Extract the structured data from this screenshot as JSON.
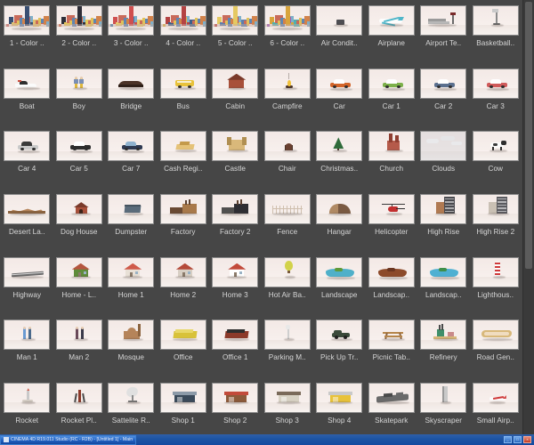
{
  "window": {
    "taskbar_title": "CINEMA 4D R19.011 Studio (RC - R2B) - [Untitled 1] - Main",
    "minimize_label": "_",
    "maximize_label": "□",
    "close_label": "×"
  },
  "browser": {
    "name": "content-browser-grid",
    "columns": 10,
    "rows": 7,
    "background_color": "#464646",
    "caption_color": "#d6d6d6",
    "thumbnail_border_color": "#8c8c8c"
  },
  "assets": [
    {
      "label": "1 - Color ..",
      "kind": "city-scene",
      "palette": [
        "#c86a6a",
        "#3a4f72",
        "#e0c070"
      ]
    },
    {
      "label": "2 - Color ..",
      "kind": "city-scene",
      "palette": [
        "#d86a4a",
        "#2e2e38",
        "#e6c85a"
      ]
    },
    {
      "label": "3 - Color ..",
      "kind": "city-scene",
      "palette": [
        "#3f7fb5",
        "#cf4f4f",
        "#e8cd6a"
      ]
    },
    {
      "label": "4 - Color ..",
      "kind": "city-scene",
      "palette": [
        "#e0b84a",
        "#b44343",
        "#3b5f8a"
      ]
    },
    {
      "label": "5 - Color ..",
      "kind": "city-scene",
      "palette": [
        "#c24a4a",
        "#e5c962",
        "#5c7fae"
      ]
    },
    {
      "label": "6 - Color ..",
      "kind": "city-scene",
      "palette": [
        "#9b5bbf",
        "#d8a43c",
        "#4fb0b0"
      ]
    },
    {
      "label": "Air Condit..",
      "kind": "air-conditioner",
      "palette": [
        "#4d4d52"
      ]
    },
    {
      "label": "Airplane",
      "kind": "airplane",
      "palette": [
        "#4fb6c9",
        "#ffffff"
      ]
    },
    {
      "label": "Airport Te..",
      "kind": "airport-terminal",
      "palette": [
        "#9a9a9a",
        "#d2b24a"
      ]
    },
    {
      "label": "Basketball..",
      "kind": "basketball-hoop",
      "palette": [
        "#888888"
      ]
    },
    {
      "label": "Boat",
      "kind": "boat",
      "palette": [
        "#ffffff",
        "#2e2e2e",
        "#c94a3c"
      ]
    },
    {
      "label": "Boy",
      "kind": "boy",
      "palette": [
        "#e0b83c",
        "#7a8fb5"
      ]
    },
    {
      "label": "Bridge",
      "kind": "bridge",
      "palette": [
        "#4a3226"
      ]
    },
    {
      "label": "Bus",
      "kind": "bus",
      "palette": [
        "#e8c23a",
        "#2e2e2e"
      ]
    },
    {
      "label": "Cabin",
      "kind": "cabin",
      "palette": [
        "#a8503a",
        "#7a3a2a"
      ]
    },
    {
      "label": "Campfire",
      "kind": "campfire",
      "palette": [
        "#f2c23a",
        "#4a3226"
      ]
    },
    {
      "label": "Car",
      "kind": "car",
      "palette": [
        "#d2652a",
        "#ffffff"
      ]
    },
    {
      "label": "Car 1",
      "kind": "car",
      "palette": [
        "#7cb04a",
        "#ffffff"
      ]
    },
    {
      "label": "Car 2",
      "kind": "car",
      "palette": [
        "#5a6f8e",
        "#ffffff"
      ]
    },
    {
      "label": "Car 3",
      "kind": "car",
      "palette": [
        "#cf5a5a",
        "#ffffff"
      ]
    },
    {
      "label": "Car 4",
      "kind": "car",
      "palette": [
        "#c9c9c9",
        "#3a3a3a"
      ]
    },
    {
      "label": "Car 5",
      "kind": "car",
      "palette": [
        "#2e2e2e",
        "#ffffff"
      ]
    },
    {
      "label": "Car 7",
      "kind": "car",
      "palette": [
        "#2f3a52",
        "#8fb2cf"
      ]
    },
    {
      "label": "Cash Regi..",
      "kind": "cash-register",
      "palette": [
        "#e5c277",
        "#c49a4a"
      ]
    },
    {
      "label": "Castle",
      "kind": "castle",
      "palette": [
        "#d9b87a",
        "#b08f52"
      ]
    },
    {
      "label": "Chair",
      "kind": "chair",
      "palette": [
        "#6a4030"
      ]
    },
    {
      "label": "Christmas..",
      "kind": "christmas-tree",
      "palette": [
        "#2f6b3a",
        "#4a3226"
      ]
    },
    {
      "label": "Church",
      "kind": "church",
      "palette": [
        "#b55a4a",
        "#8f3f32"
      ]
    },
    {
      "label": "Clouds",
      "kind": "clouds",
      "palette": [
        "#d8dadd",
        "#ffffff"
      ]
    },
    {
      "label": "Cow",
      "kind": "cow",
      "palette": [
        "#ffffff",
        "#2e2e2e"
      ]
    },
    {
      "label": "Desert La..",
      "kind": "desert-landscape",
      "palette": [
        "#b5845a",
        "#8c6440"
      ]
    },
    {
      "label": "Dog House",
      "kind": "dog-house",
      "palette": [
        "#a8503a",
        "#7a3a2a"
      ]
    },
    {
      "label": "Dumpster",
      "kind": "dumpster",
      "palette": [
        "#5a6b7a",
        "#46545f"
      ]
    },
    {
      "label": "Factory",
      "kind": "factory",
      "palette": [
        "#a8794a",
        "#6a4a33"
      ]
    },
    {
      "label": "Factory 2",
      "kind": "factory",
      "palette": [
        "#2e2e33",
        "#50504f"
      ]
    },
    {
      "label": "Fence",
      "kind": "fence",
      "palette": [
        "#cfbfae"
      ]
    },
    {
      "label": "Hangar",
      "kind": "hangar",
      "palette": [
        "#7a5a42",
        "#b08a64"
      ]
    },
    {
      "label": "Helicopter",
      "kind": "helicopter",
      "palette": [
        "#c22f2f",
        "#2e2e2e"
      ]
    },
    {
      "label": "High Rise",
      "kind": "high-rise",
      "palette": [
        "#4a4a4f",
        "#b07a52"
      ]
    },
    {
      "label": "High Rise 2",
      "kind": "high-rise",
      "palette": [
        "#5a5a5f",
        "#c9c0b4"
      ]
    },
    {
      "label": "Highway",
      "kind": "highway",
      "palette": [
        "#6a6a6a",
        "#4a4a4a"
      ]
    },
    {
      "label": "Home - L..",
      "kind": "house",
      "palette": [
        "#b5563f",
        "#5f8c3a"
      ]
    },
    {
      "label": "Home 1",
      "kind": "house",
      "palette": [
        "#cf5a4a",
        "#e8e0d6"
      ]
    },
    {
      "label": "Home 2",
      "kind": "house",
      "palette": [
        "#b54a3a",
        "#d8cfc4"
      ]
    },
    {
      "label": "Home 3",
      "kind": "house",
      "palette": [
        "#c24a3a",
        "#ffffff"
      ]
    },
    {
      "label": "Hot Air Ba..",
      "kind": "hot-air-balloon",
      "palette": [
        "#d2d24a",
        "#9aa83a"
      ]
    },
    {
      "label": "Landscape",
      "kind": "landscape",
      "palette": [
        "#4fb0c9",
        "#5f9a3a"
      ]
    },
    {
      "label": "Landscap..",
      "kind": "landscape",
      "palette": [
        "#8c4a2a",
        "#6a3520"
      ]
    },
    {
      "label": "Landscap..",
      "kind": "landscape",
      "palette": [
        "#4fb0d2",
        "#3f8f4a"
      ]
    },
    {
      "label": "Lighthous..",
      "kind": "lighthouse",
      "palette": [
        "#cf3a3a",
        "#ffffff"
      ]
    },
    {
      "label": "Man 1",
      "kind": "man",
      "palette": [
        "#6a9ad2",
        "#4a6a8c"
      ]
    },
    {
      "label": "Man 2",
      "kind": "man",
      "palette": [
        "#6a4a5a",
        "#3a3a4a"
      ]
    },
    {
      "label": "Mosque",
      "kind": "mosque",
      "palette": [
        "#b5845a",
        "#8c6440"
      ]
    },
    {
      "label": "Office",
      "kind": "office",
      "palette": [
        "#d8c23a",
        "#e8d86a"
      ]
    },
    {
      "label": "Office 1",
      "kind": "office",
      "palette": [
        "#8c3a2a",
        "#2e2e2e"
      ]
    },
    {
      "label": "Parking M..",
      "kind": "parking-meter",
      "palette": [
        "#e8e8e8",
        "#9a9a9a"
      ]
    },
    {
      "label": "Pick Up Tr..",
      "kind": "pickup-truck",
      "palette": [
        "#3a4a3a",
        "#2e2e2e"
      ]
    },
    {
      "label": "Picnic Tab..",
      "kind": "picnic-table",
      "palette": [
        "#b5854a",
        "#8c6440"
      ]
    },
    {
      "label": "Refinery",
      "kind": "refinery",
      "palette": [
        "#3f8f6a",
        "#c98a8a"
      ]
    },
    {
      "label": "Road Gen..",
      "kind": "road-generator",
      "palette": [
        "#d8b87a",
        "#4a4a4a"
      ]
    },
    {
      "label": "Rocket",
      "kind": "rocket",
      "palette": [
        "#c9c9c9",
        "#cf5a4a"
      ]
    },
    {
      "label": "Rocket Pl..",
      "kind": "rocket-platform",
      "palette": [
        "#8c3a2a",
        "#4a4a4a"
      ]
    },
    {
      "label": "Sattelite R..",
      "kind": "satellite-dish",
      "palette": [
        "#e0e0e0",
        "#9a9a9a"
      ]
    },
    {
      "label": "Shop 1",
      "kind": "shop",
      "palette": [
        "#3a4a5a",
        "#8c9aa8"
      ]
    },
    {
      "label": "Shop 2",
      "kind": "shop",
      "palette": [
        "#8c5a3a",
        "#c24a3a"
      ]
    },
    {
      "label": "Shop 3",
      "kind": "shop",
      "palette": [
        "#d8d2c4",
        "#7a6a5a"
      ]
    },
    {
      "label": "Shop 4",
      "kind": "shop",
      "palette": [
        "#e8c23a",
        "#c9c9c9"
      ]
    },
    {
      "label": "Skatepark",
      "kind": "skatepark",
      "palette": [
        "#6a6a6a",
        "#4a4a4a"
      ]
    },
    {
      "label": "Skyscraper",
      "kind": "skyscraper",
      "palette": [
        "#c9c9c9",
        "#9a9a9a"
      ]
    },
    {
      "label": "Small Airp..",
      "kind": "small-airplane",
      "palette": [
        "#cf3a3a",
        "#ffffff"
      ]
    }
  ]
}
